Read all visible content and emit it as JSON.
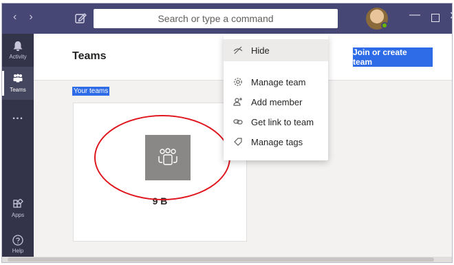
{
  "titlebar": {
    "search_placeholder": "Search or type a command",
    "back_icon": "chevron-left-icon",
    "forward_icon": "chevron-right-icon"
  },
  "rail": {
    "items": [
      {
        "label": "Activity",
        "icon": "bell-icon"
      },
      {
        "label": "Teams",
        "icon": "teams-icon"
      },
      {
        "label": "...",
        "icon": "more-icon"
      },
      {
        "label": "Apps",
        "icon": "apps-icon"
      },
      {
        "label": "Help",
        "icon": "help-icon"
      }
    ]
  },
  "main": {
    "title": "Teams",
    "join_label": "Join or create team",
    "your_teams_label": "Your teams",
    "team": {
      "name": "9 B"
    }
  },
  "menu": {
    "items": [
      {
        "label": "Hide",
        "icon": "hide-icon"
      },
      {
        "label": "Manage team",
        "icon": "gear-icon"
      },
      {
        "label": "Add member",
        "icon": "add-person-icon"
      },
      {
        "label": "Get link to team",
        "icon": "link-icon"
      },
      {
        "label": "Manage tags",
        "icon": "tag-icon"
      }
    ]
  },
  "colors": {
    "titlebar": "#464775",
    "rail": "#33344a",
    "accent": "#2e6be6",
    "annotation": "#e0161e"
  }
}
